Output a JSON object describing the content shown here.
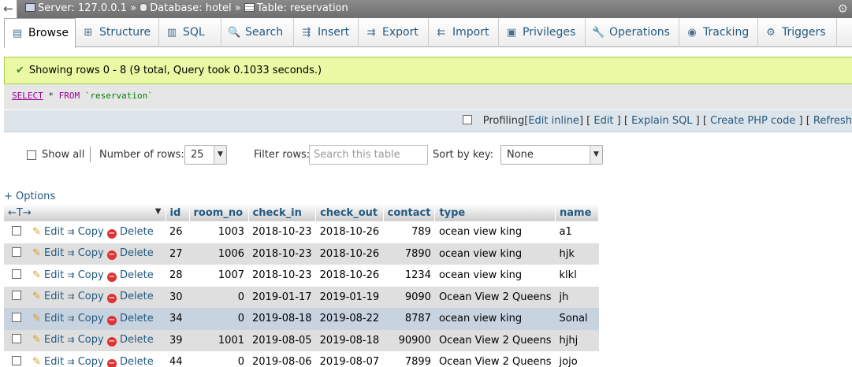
{
  "breadcrumb": {
    "back": "←",
    "server": "Server: 127.0.0.1",
    "database": "Database: hotel",
    "table": "Table: reservation",
    "sep": "»"
  },
  "tabs": [
    {
      "label": "Browse",
      "icon": "browse-icon",
      "glyph": "▤"
    },
    {
      "label": "Structure",
      "icon": "structure-icon",
      "glyph": "⊞"
    },
    {
      "label": "SQL",
      "icon": "sql-icon",
      "glyph": "▥"
    },
    {
      "label": "Search",
      "icon": "search-icon",
      "glyph": "🔍"
    },
    {
      "label": "Insert",
      "icon": "insert-icon",
      "glyph": "⇶"
    },
    {
      "label": "Export",
      "icon": "export-icon",
      "glyph": "⇉"
    },
    {
      "label": "Import",
      "icon": "import-icon",
      "glyph": "⇇"
    },
    {
      "label": "Privileges",
      "icon": "privileges-icon",
      "glyph": "▣"
    },
    {
      "label": "Operations",
      "icon": "operations-icon",
      "glyph": "🔧"
    },
    {
      "label": "Tracking",
      "icon": "tracking-icon",
      "glyph": "◉"
    },
    {
      "label": "Triggers",
      "icon": "triggers-icon",
      "glyph": "⚙"
    }
  ],
  "success_message": "Showing rows 0 - 8 (9 total, Query took 0.1033 seconds.)",
  "sql": {
    "select": "SELECT",
    "star": "*",
    "from": "FROM",
    "table": "`reservation`"
  },
  "tools": {
    "profiling": "Profiling",
    "edit_inline": "Edit inline",
    "edit": "Edit",
    "explain": "Explain SQL",
    "php": "Create PHP code",
    "refresh": "Refresh"
  },
  "nav": {
    "show_all": "Show all",
    "rows_label": "Number of rows:",
    "rows_value": "25",
    "filter_label": "Filter rows:",
    "filter_placeholder": "Search this table",
    "sort_label": "Sort by key:",
    "sort_value": "None"
  },
  "options_link": "+ Options",
  "table": {
    "columns": [
      "id",
      "room_no",
      "check_in",
      "check_out",
      "contact",
      "type",
      "name"
    ],
    "actions": {
      "edit": "Edit",
      "copy": "Copy",
      "delete": "Delete"
    },
    "rows": [
      {
        "id": "26",
        "room_no": "1003",
        "check_in": "2018-10-23",
        "check_out": "2018-10-26",
        "contact": "789",
        "type": "ocean view king",
        "name": "a1"
      },
      {
        "id": "27",
        "room_no": "1006",
        "check_in": "2018-10-23",
        "check_out": "2018-10-26",
        "contact": "7890",
        "type": "ocean view king",
        "name": "hjk"
      },
      {
        "id": "28",
        "room_no": "1007",
        "check_in": "2018-10-23",
        "check_out": "2018-10-26",
        "contact": "1234",
        "type": "ocean view king",
        "name": "klkl"
      },
      {
        "id": "30",
        "room_no": "0",
        "check_in": "2019-01-17",
        "check_out": "2019-01-19",
        "contact": "9090",
        "type": "Ocean View 2 Queens",
        "name": "jh"
      },
      {
        "id": "34",
        "room_no": "0",
        "check_in": "2019-08-18",
        "check_out": "2019-08-22",
        "contact": "8787",
        "type": "ocean view king",
        "name": "Sonal"
      },
      {
        "id": "39",
        "room_no": "1001",
        "check_in": "2019-08-05",
        "check_out": "2019-08-18",
        "contact": "90900",
        "type": "Ocean View 2 Queens",
        "name": "hjhj"
      },
      {
        "id": "44",
        "room_no": "0",
        "check_in": "2019-08-06",
        "check_out": "2019-08-07",
        "contact": "7899",
        "type": "Ocean View 2 Queens",
        "name": "jojo"
      }
    ]
  },
  "colors": {
    "link": "#235a81",
    "success_bg": "#ebf8a4",
    "selected_row": "#c8d3e0"
  }
}
